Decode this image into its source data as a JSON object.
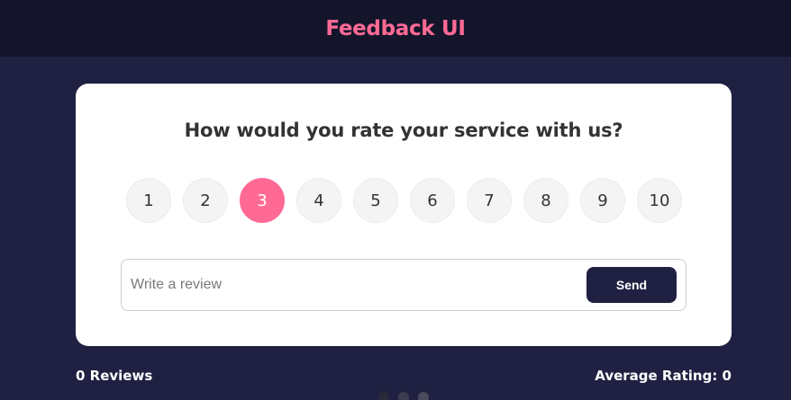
{
  "header": {
    "title": "Feedback UI"
  },
  "card": {
    "question": "How would you rate your service with us?",
    "ratings": [
      "1",
      "2",
      "3",
      "4",
      "5",
      "6",
      "7",
      "8",
      "9",
      "10"
    ],
    "selected_rating": "3",
    "review": {
      "placeholder": "Write a review",
      "value": ""
    },
    "send_label": "Send"
  },
  "stats": {
    "reviews": "0 Reviews",
    "average": "Average Rating: 0"
  },
  "colors": {
    "accent": "#ff6a95",
    "background": "#202142",
    "header_background": "#14152b",
    "card_background": "#ffffff"
  }
}
